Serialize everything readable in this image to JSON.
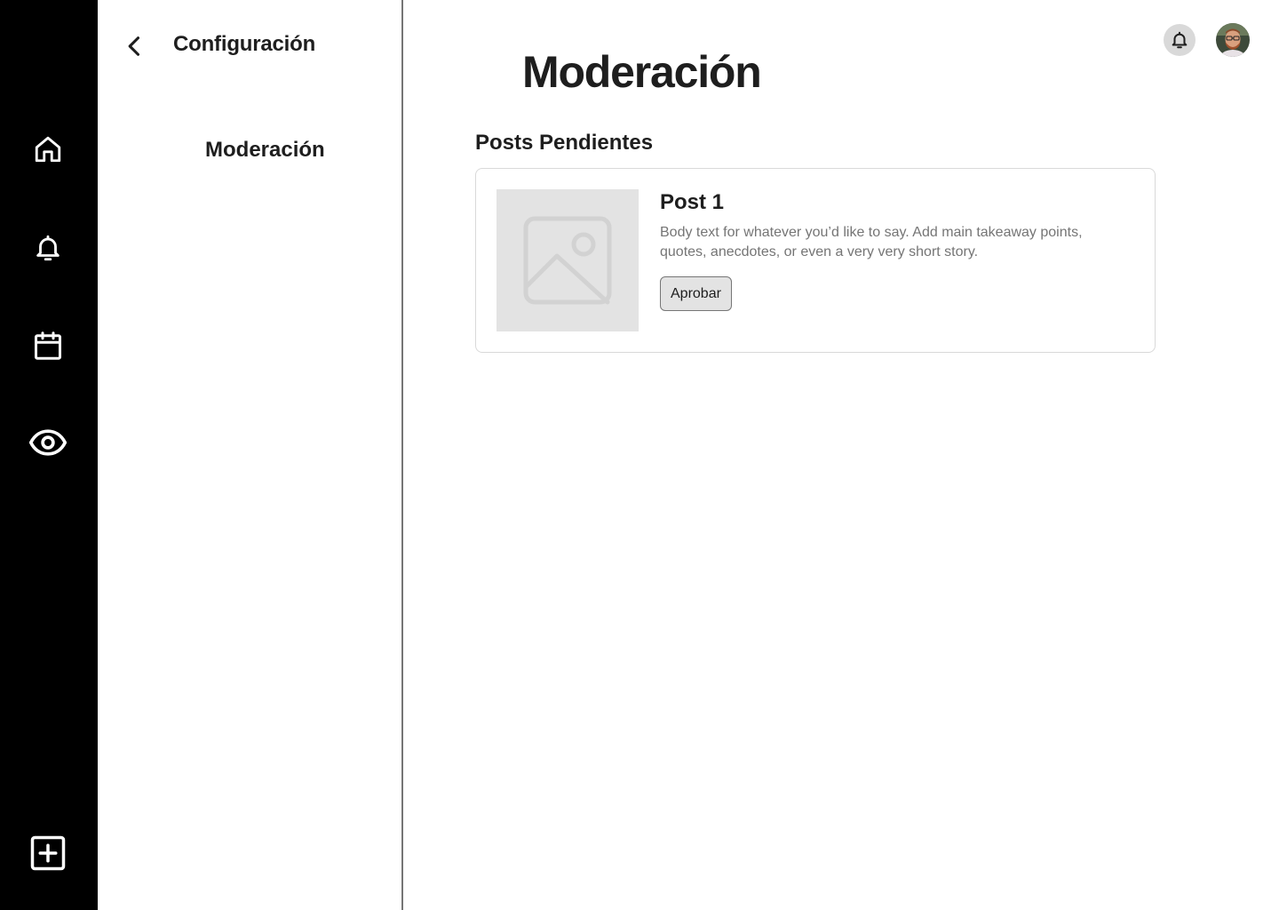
{
  "rail": {
    "items": [
      {
        "icon": "home-icon"
      },
      {
        "icon": "bell-icon"
      },
      {
        "icon": "calendar-icon"
      },
      {
        "icon": "eye-icon"
      }
    ],
    "create_icon": "plus-square-icon"
  },
  "settings_panel": {
    "back_icon": "chevron-left-icon",
    "title": "Configuración",
    "items": [
      {
        "label": "Moderación"
      }
    ]
  },
  "header": {
    "notification_icon": "bell-icon",
    "avatar_icon": "user-avatar"
  },
  "main": {
    "title": "Moderación",
    "section_title": "Posts Pendientes",
    "posts": [
      {
        "title": "Post 1",
        "body": "Body text for whatever you’d like to say. Add main takeaway points, quotes, anecdotes, or even a very very short story.",
        "action_label": "Aprobar",
        "image_icon": "image-placeholder-icon"
      }
    ]
  },
  "colors": {
    "rail_background": "#000000",
    "text_primary": "#1e1e1e",
    "text_secondary": "#757575",
    "placeholder_gray": "#e3e3e3",
    "border": "#d9d9d9"
  }
}
